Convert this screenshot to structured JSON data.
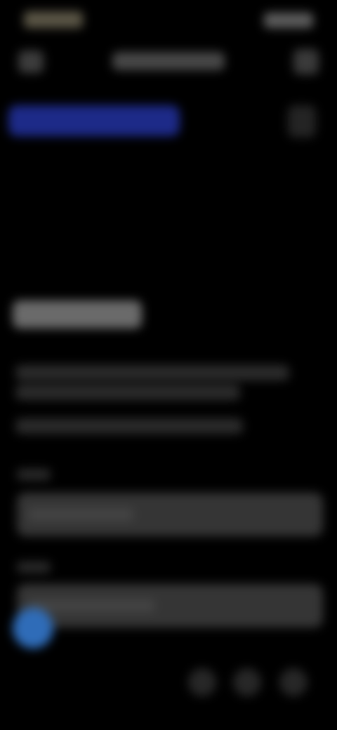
{
  "status_bar": {
    "time": "",
    "icons": [
      "signal-icon",
      "wifi-icon",
      "battery-icon"
    ]
  },
  "app_bar": {
    "title": "",
    "back_icon": "arrow-back-icon",
    "more_icon": "more-vert-icon"
  },
  "highlight": {
    "label": ""
  },
  "section": {
    "heading": "",
    "description": [
      "",
      "",
      ""
    ]
  },
  "form": {
    "fields": [
      {
        "label": "",
        "value": ""
      },
      {
        "label": "",
        "value": ""
      }
    ]
  },
  "colors": {
    "background": "#000000",
    "accent_chip": "#1d2a88",
    "touch_indicator": "#2f6cb8",
    "field_background": "#353535"
  }
}
